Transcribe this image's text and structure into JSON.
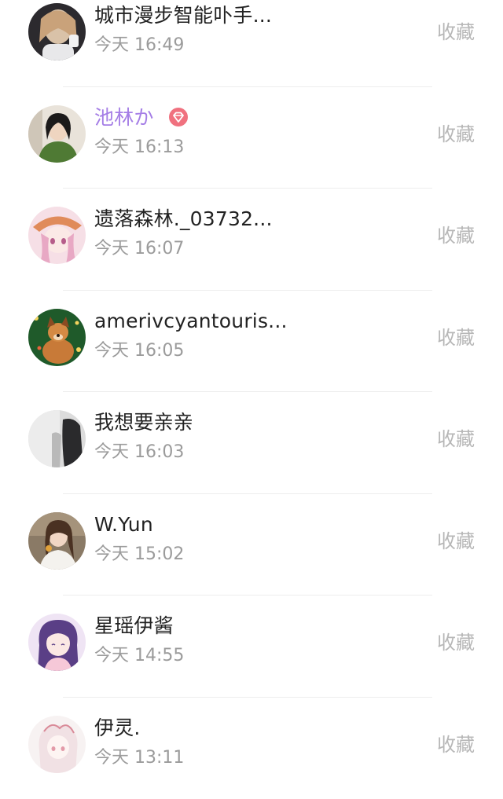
{
  "favorite_label": "收藏",
  "vip_color": "#a57ee6",
  "items": [
    {
      "name": "城市漫步智能卟手...",
      "time": "今天 16:49"
    },
    {
      "name": "池林か",
      "time": "今天 16:13",
      "vip": true
    },
    {
      "name": "遗落森林._03732...",
      "time": "今天 16:07"
    },
    {
      "name": "amerivcyantouris...",
      "time": "今天 16:05"
    },
    {
      "name": "我想要亲亲",
      "time": "今天 16:03"
    },
    {
      "name": "W.Yun",
      "time": "今天 15:02"
    },
    {
      "name": "星瑶伊酱",
      "time": "今天 14:55"
    },
    {
      "name": "伊灵.",
      "time": "今天 13:11"
    }
  ]
}
